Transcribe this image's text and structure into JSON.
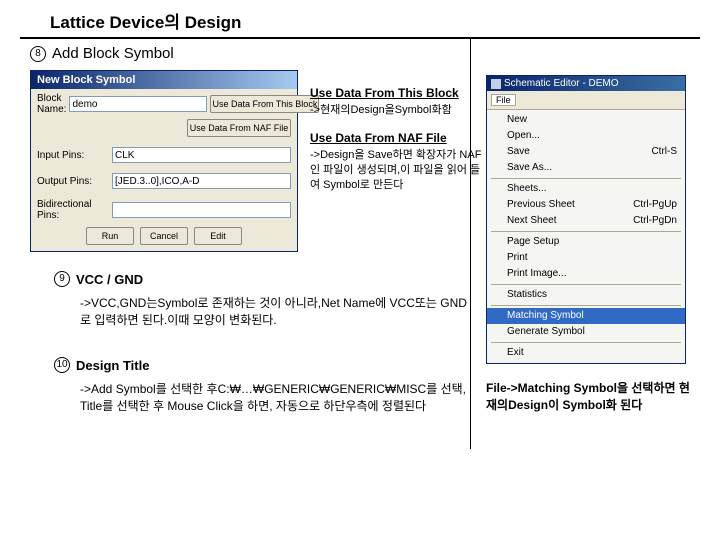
{
  "page_title": "Lattice Device의 Design",
  "step8": {
    "num": "8",
    "label": "Add Block Symbol"
  },
  "dialog": {
    "title": "New Block Symbol",
    "block_name_label": "Block Name:",
    "block_name_value": "demo",
    "btn_use_block": "Use Data From This Block",
    "btn_use_naf": "Use Data From NAF File",
    "input_pins_label": "Input Pins:",
    "input_pins_value": "CLK",
    "output_pins_label": "Output Pins:",
    "output_pins_value": "[JED.3..0],ICO,A-D",
    "bidir_pins_label": "Bidirectional Pins:",
    "bidir_pins_value": "",
    "run": "Run",
    "cancel": "Cancel",
    "edit": "Edit"
  },
  "side": {
    "h1": "Use Data From This Block",
    "d1": "->현재의Design을Symbol화함",
    "h2": "Use Data From NAF File",
    "d2": "->Design을 Save하면 확장자가 NAF인 파일이 생성되며,이 파일을 읽어 들여 Symbol로 만든다"
  },
  "step9": {
    "num": "9",
    "label": "VCC / GND",
    "desc": "->VCC,GND는Symbol로 존재하는 것이 아니라,Net Name에 VCC또는 GND로 입력하면 된다.이때 모양이 변화된다."
  },
  "step10": {
    "num": "10",
    "label": "Design Title",
    "desc": "->Add Symbol를 선택한 후C:₩…₩GENERIC₩GENERIC₩MISC를 선택, Title를 선택한 후 Mouse Click을 하면, 자동으로 하단우측에 정렬된다"
  },
  "menu": {
    "title": "Schematic Editor - DEMO",
    "tab_file": "File",
    "items": [
      {
        "l": "New",
        "r": ""
      },
      {
        "l": "Open...",
        "r": ""
      },
      {
        "l": "Save",
        "r": "Ctrl-S"
      },
      {
        "l": "Save As...",
        "r": ""
      }
    ],
    "items2": [
      {
        "l": "Sheets...",
        "r": ""
      },
      {
        "l": "Previous Sheet",
        "r": "Ctrl-PgUp"
      },
      {
        "l": "Next Sheet",
        "r": "Ctrl-PgDn"
      }
    ],
    "items3": [
      {
        "l": "Page Setup",
        "r": ""
      },
      {
        "l": "Print",
        "r": ""
      },
      {
        "l": "Print Image...",
        "r": ""
      }
    ],
    "items4": [
      {
        "l": "Statistics",
        "r": ""
      }
    ],
    "items5": [
      {
        "l": "Matching Symbol",
        "r": "",
        "hi": true
      },
      {
        "l": "Generate Symbol",
        "r": ""
      }
    ],
    "items6": [
      {
        "l": "Exit",
        "r": ""
      }
    ]
  },
  "right_note": "File->Matching Symbol을 선택하면 현재의Design이 Symbol화 된다"
}
